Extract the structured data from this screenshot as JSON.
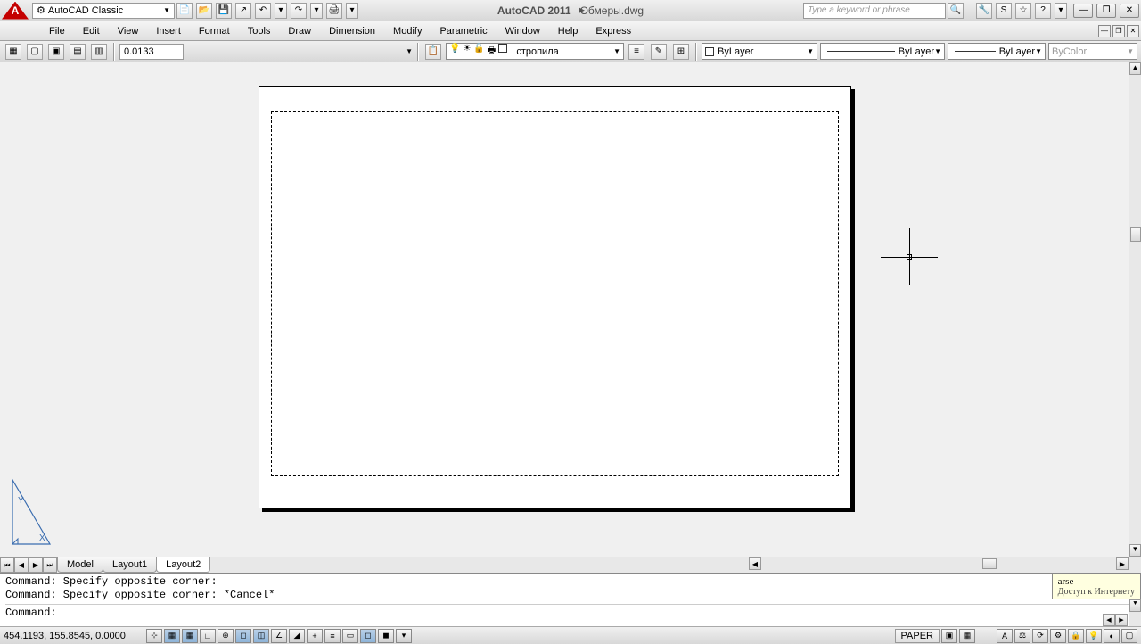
{
  "title": {
    "app": "AutoCAD 2011",
    "doc": "Обмеры.dwg"
  },
  "workspace": "AutoCAD Classic",
  "search_placeholder": "Type a keyword or phrase",
  "menu": [
    "File",
    "Edit",
    "View",
    "Insert",
    "Format",
    "Tools",
    "Draw",
    "Dimension",
    "Modify",
    "Parametric",
    "Window",
    "Help",
    "Express"
  ],
  "lineweight_value": "0.0133",
  "layer": {
    "name": "стропила",
    "color_prop": "ByLayer",
    "linetype_prop": "ByLayer",
    "lineweight_prop": "ByLayer",
    "plotstyle_prop": "ByColor"
  },
  "tabs": {
    "model": "Model",
    "layout1": "Layout1",
    "layout2": "Layout2"
  },
  "command": {
    "line1": "Command: Specify opposite corner:",
    "line2": "Command: Specify opposite corner: *Cancel*",
    "prompt": "Command:"
  },
  "tooltip": {
    "line1": "arse",
    "line2": "Доступ к Интернету"
  },
  "status": {
    "coords": "454.1193, 155.8545, 0.0000",
    "space": "PAPER"
  },
  "chart_data": null
}
